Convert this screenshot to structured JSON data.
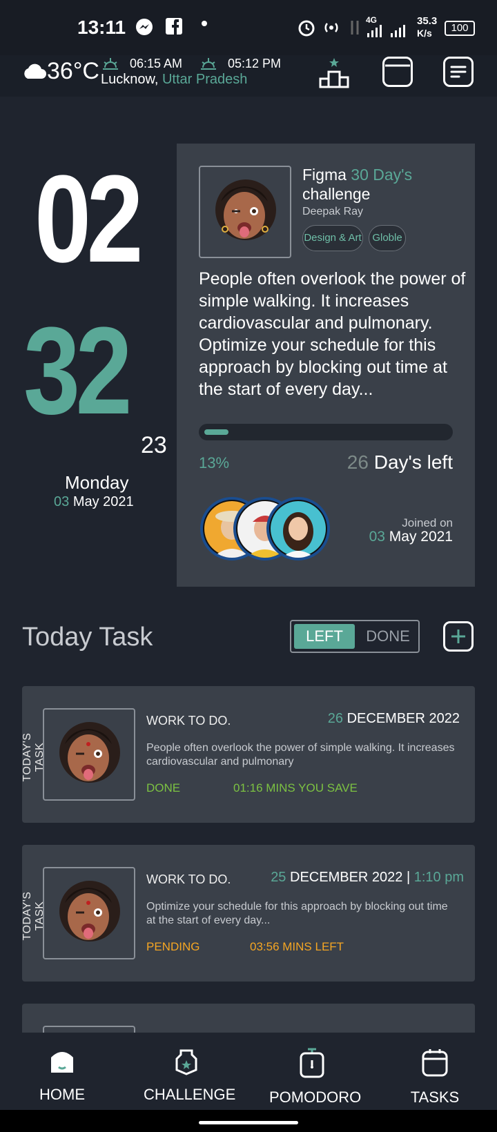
{
  "status_bar": {
    "time": "13:11",
    "network": "4G",
    "speed_value": "35.3",
    "speed_unit": "K/s",
    "battery": "100"
  },
  "weather": {
    "temperature": "36°C",
    "sunrise": "06:15 AM",
    "sunset": "05:12 PM",
    "city": "Lucknow,",
    "state": "Uttar Pradesh",
    "icons": [
      "cloud-icon",
      "sunrise-icon",
      "sunset-icon",
      "leaderboard-icon",
      "calendar-icon",
      "menu-list-icon"
    ]
  },
  "clock": {
    "hours": "02",
    "minutes": "32",
    "seconds": "23",
    "weekday": "Monday",
    "day": "03",
    "month_year": "May 2021"
  },
  "challenge": {
    "title_prefix": "Figma",
    "title_highlight": "30 Day's",
    "title_suffix": "challenge",
    "author": "Deepak Ray",
    "tags": [
      "Design & Art",
      "Globle"
    ],
    "description": "People often overlook the power of simple walking. It increases cardiovascular and pulmonary. Optimize your schedule for this approach by blocking out time at the start of every day...",
    "progress_percent": 13,
    "progress_label": "13%",
    "days_left_number": "26",
    "days_left_label": "Day's left",
    "joined_label": "Joined on",
    "joined_day": "03",
    "joined_month_year": "May 2021"
  },
  "today_task": {
    "heading": "Today Task",
    "toggle_left": "LEFT",
    "toggle_done": "DONE",
    "side_label": "TODAY'S TASK",
    "tasks": [
      {
        "title": "WORK TO DO.",
        "date_day": "26",
        "date_rest": "DECEMBER 2022",
        "date_sep": "",
        "date_time": "",
        "description": "People often overlook the power of simple walking. It increases cardiovascular and pulmonary",
        "status": "DONE",
        "time_info": "01:16 MINS YOU SAVE"
      },
      {
        "title": "WORK TO DO.",
        "date_day": "25",
        "date_rest": "DECEMBER 2022",
        "date_sep": "|",
        "date_time": "1:10 pm",
        "description": "Optimize your schedule for this approach by blocking out time at the start of every day...",
        "status": "PENDING",
        "time_info": "03:56 MINS LEFT"
      }
    ]
  },
  "bottom_nav": {
    "items": [
      "HOME",
      "CHALLENGE",
      "POMODORO",
      "TASKS"
    ]
  },
  "colors": {
    "accent": "#5aa897",
    "done": "#7cc242",
    "pending": "#f5a623",
    "card": "#3a4049",
    "background": "#1f242e"
  }
}
